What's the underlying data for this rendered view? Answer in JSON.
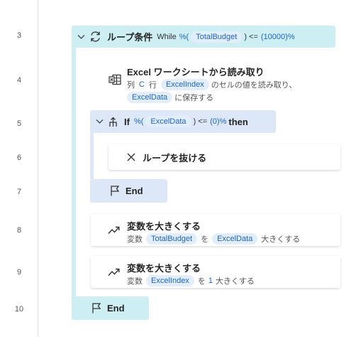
{
  "line_numbers": [
    "3",
    "4",
    "5",
    "6",
    "7",
    "8",
    "9",
    "10"
  ],
  "loop": {
    "title": "ループ条件",
    "keyword": "While",
    "open": "%(",
    "variable": "TotalBudget",
    "operator": ") <=",
    "value": "(10000)%",
    "end_label": "End"
  },
  "excel_read": {
    "title": "Excel ワークシートから読み取り",
    "col_label": "列",
    "col_value": "C",
    "row_label": "行",
    "row_variable": "ExcelIndex",
    "tail_text": "のセルの値を読み取り、",
    "output_variable": "ExcelData",
    "save_text": "に保存する"
  },
  "if_block": {
    "keyword": "If",
    "open": "%(",
    "variable": "ExcelData",
    "operator": ") <=",
    "value": "(0)%",
    "then": "then",
    "end_label": "End"
  },
  "exit_loop": {
    "title": "ループを抜ける"
  },
  "increase_1": {
    "title": "変数を大きくする",
    "label": "変数",
    "variable": "TotalBudget",
    "particle": "を",
    "amount_variable": "ExcelData",
    "suffix": "大きくする"
  },
  "increase_2": {
    "title": "変数を大きくする",
    "label": "変数",
    "variable": "ExcelIndex",
    "particle": "を",
    "amount": "1",
    "suffix": "大きくする"
  },
  "colors": {
    "loop_block": "#cdeef3",
    "if_block": "#dce7f8",
    "token_bg": "#e3eefc",
    "token_text": "#1e64c8"
  },
  "icons": [
    "chevron-down-icon",
    "loop-icon",
    "excel-sheet-icon",
    "condition-icon",
    "close-icon",
    "flag-icon",
    "trend-up-icon"
  ]
}
